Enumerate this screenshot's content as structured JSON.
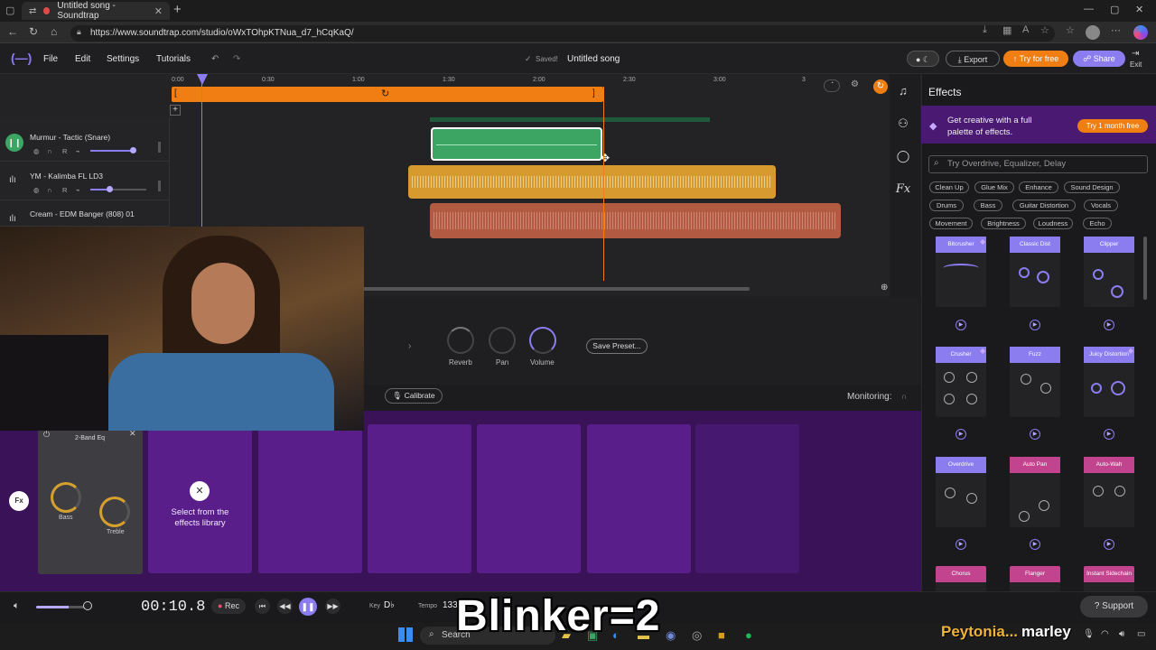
{
  "browser": {
    "tab_title": "Untitled song - Soundtrap",
    "url": "https://www.soundtrap.com/studio/oWxTOhpKTNua_d7_hCqKaQ/"
  },
  "app": {
    "menu": [
      "File",
      "Edit",
      "Settings",
      "Tutorials"
    ],
    "saved": "Saved!",
    "song_title": "Untitled song",
    "export_label": "Export",
    "try_label": "Try for free",
    "share_label": "Share",
    "exit_label": "Exit"
  },
  "ruler": [
    "0:00",
    "0:30",
    "1:00",
    "1:30",
    "2:00",
    "2:30",
    "3:00",
    "3"
  ],
  "tracks": [
    {
      "name": "Murmur - Tactic (Snare)",
      "r": "R"
    },
    {
      "name": "YM - Kalimba FL LD3",
      "r": "R"
    },
    {
      "name": "Cream - EDM Banger (808) 01",
      "r": "R"
    }
  ],
  "mixer": {
    "reverb": "Reverb",
    "pan": "Pan",
    "volume": "Volume",
    "save_preset": "Save Preset...",
    "calibrate": "Calibrate",
    "monitoring": "Monitoring:"
  },
  "fx": {
    "fx_label": "Fx",
    "eq_title": "2-Band Eq",
    "bass": "Bass",
    "treble": "Treble",
    "select_text_1": "Select from the",
    "select_text_2": "effects library"
  },
  "effects": {
    "title": "Effects",
    "promo_1": "Get creative with a full",
    "promo_2": "palette of effects.",
    "promo_btn": "Try 1 month free",
    "search_placeholder": "Try Overdrive, Equalizer, Delay",
    "chips": [
      "Clean Up",
      "Glue Mix",
      "Enhance",
      "Sound Design",
      "Drums",
      "Bass",
      "Guitar Distortion",
      "Vocals",
      "Movement",
      "Brightness",
      "Loudness",
      "Echo"
    ],
    "cards": [
      "Bitcrusher",
      "Classic Dist",
      "Clipper",
      "Crusher",
      "Fuzz",
      "Juicy Distortion",
      "Overdrive",
      "Auto Pan",
      "Auto-Wah",
      "Chorus",
      "Flanger",
      "Instant Sidechain"
    ]
  },
  "transport": {
    "time": "00:10.8",
    "rec": "Rec",
    "key_label": "Key",
    "key_value": "D♭",
    "tempo_label": "Tempo",
    "tempo_value": "133",
    "support": "Support"
  },
  "overlay": {
    "text": "Blinker=2",
    "name_1": "Peytonia...",
    "name_2": "marley",
    "taskbar_search": "Search"
  },
  "colors": {
    "accent": "#8b7cf0",
    "orange": "#f07e12",
    "green": "#3ca564",
    "yellow": "#d69a2e",
    "red": "#b35a42",
    "purple": "#3a1258"
  }
}
